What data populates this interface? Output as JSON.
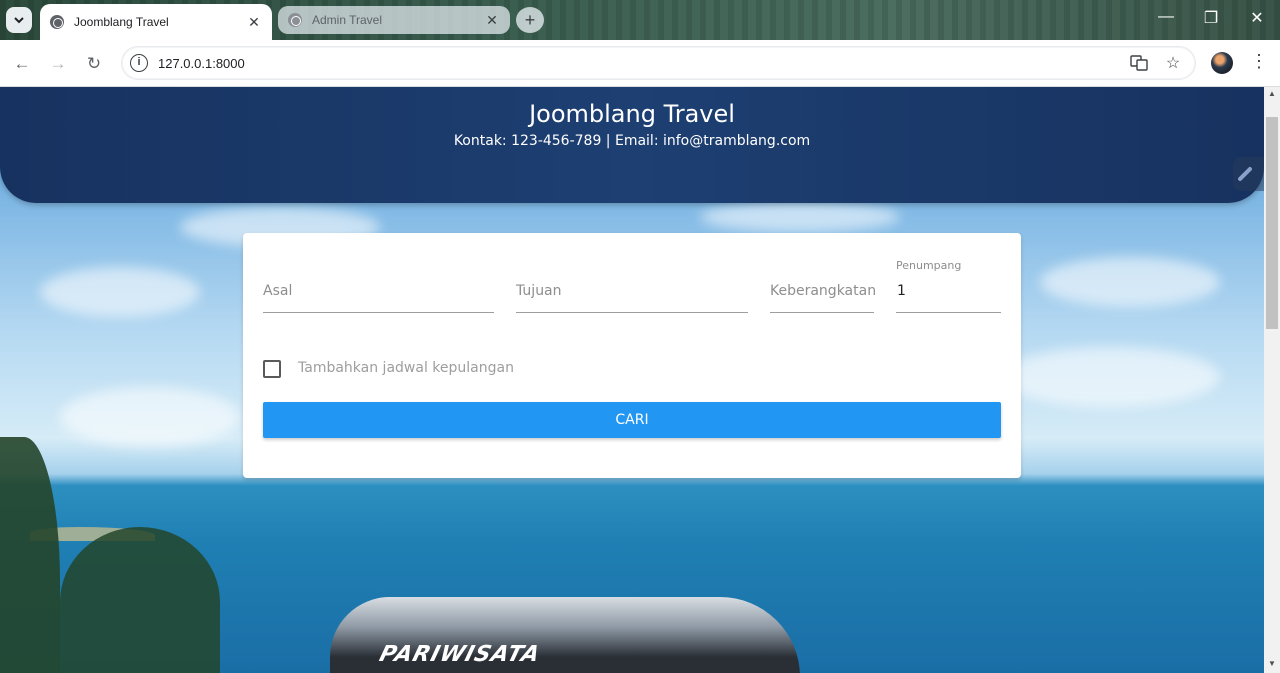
{
  "browser": {
    "tabs": [
      {
        "title": "Joomblang Travel",
        "active": true
      },
      {
        "title": "Admin Travel",
        "active": false
      }
    ],
    "url": "127.0.0.1:8000"
  },
  "header": {
    "title": "Joomblang Travel",
    "contact": "Kontak: 123-456-789 | Email: info@tramblang.com"
  },
  "search_form": {
    "origin_placeholder": "Asal",
    "destination_placeholder": "Tujuan",
    "departure_placeholder": "Keberangkatan",
    "passengers_label": "Penumpang",
    "passengers_value": "1",
    "return_checkbox_label": "Tambahkan jadwal kepulangan",
    "return_checked": false,
    "submit_label": "CARI"
  },
  "background": {
    "bus_text": "PARIWISATA"
  },
  "colors": {
    "header_bg": "#1d3f72",
    "button": "#2196f3"
  }
}
